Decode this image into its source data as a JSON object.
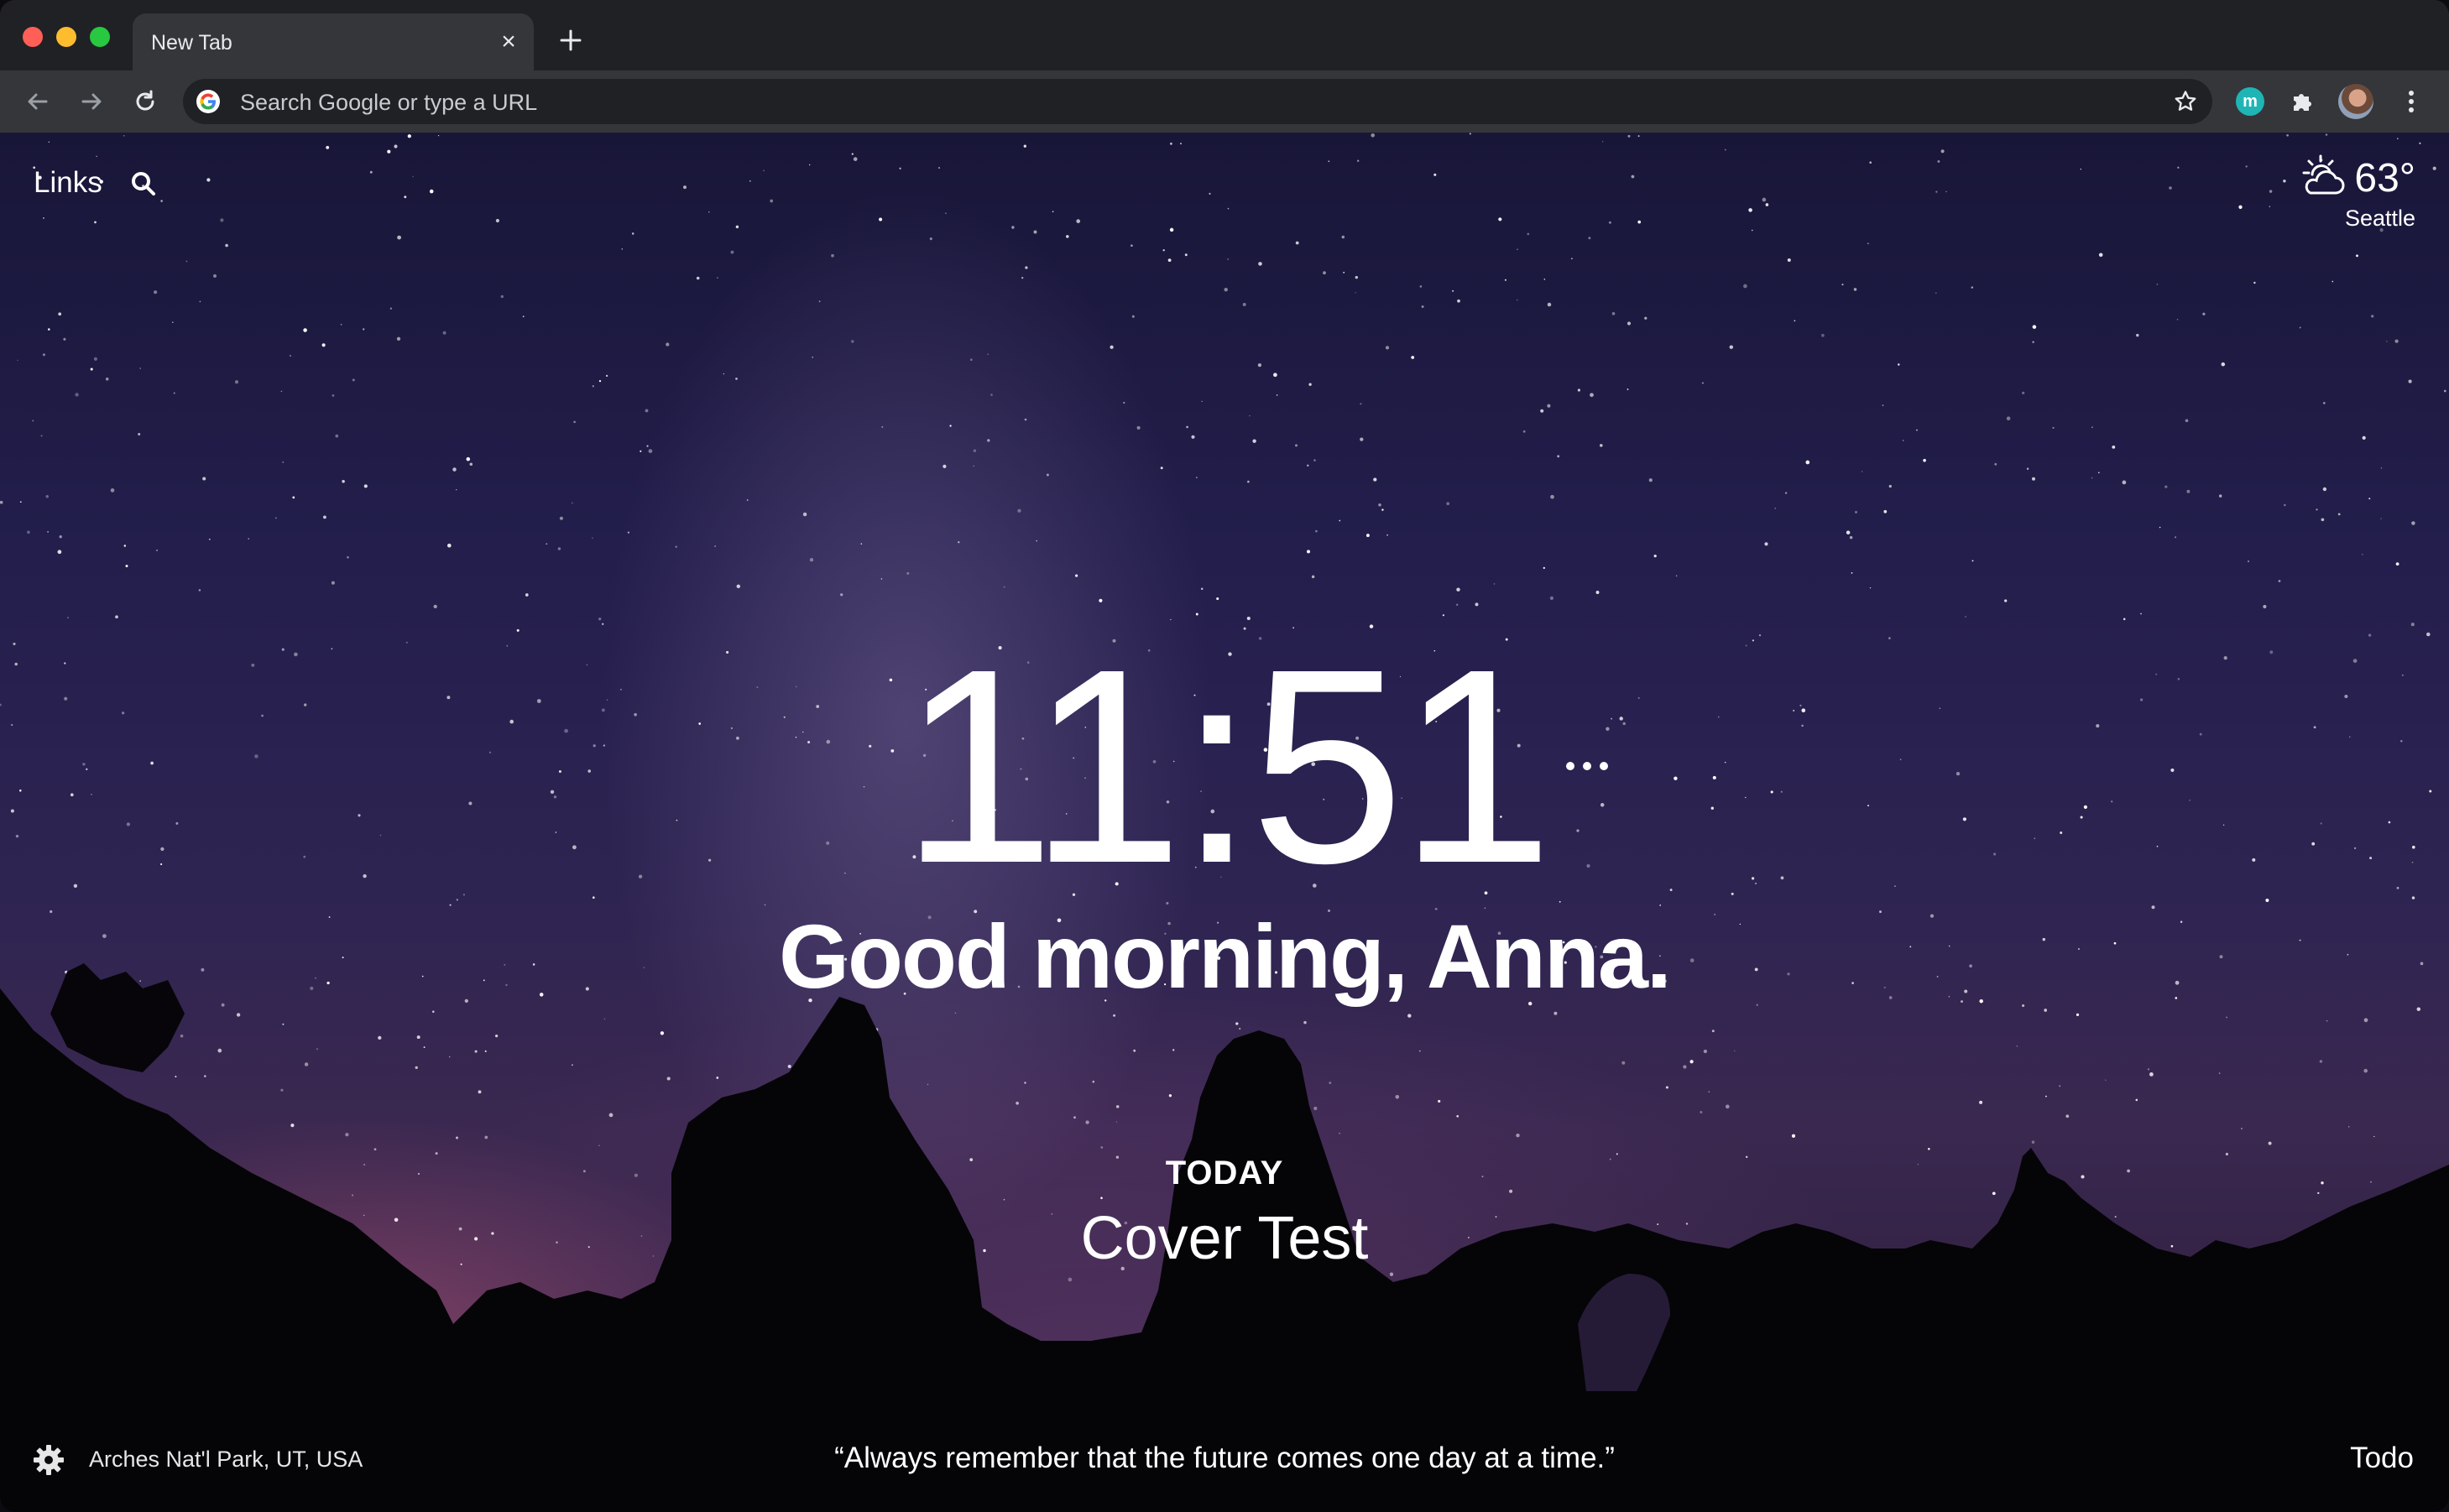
{
  "browser": {
    "tab": {
      "title": "New Tab"
    },
    "omnibox": {
      "placeholder": "Search Google or type a URL"
    },
    "extensions": {
      "m_label": "m"
    }
  },
  "dashboard": {
    "top_left": {
      "links_label": "Links"
    },
    "weather": {
      "temperature": "63°",
      "city": "Seattle",
      "icon": "partly-cloudy-day-icon"
    },
    "clock": {
      "time": "11:51"
    },
    "greeting": "Good morning, Anna.",
    "focus": {
      "label": "TODAY",
      "text": "Cover Test"
    },
    "footer": {
      "photo_location": "Arches Nat'l Park, UT, USA",
      "quote": "“Always remember that the future comes one day at a time.”",
      "todo_label": "Todo"
    }
  },
  "colors": {
    "chrome_dark": "#202124",
    "toolbar": "#35363a",
    "sky_top": "#181638",
    "sky_glow": "#be5a82"
  }
}
